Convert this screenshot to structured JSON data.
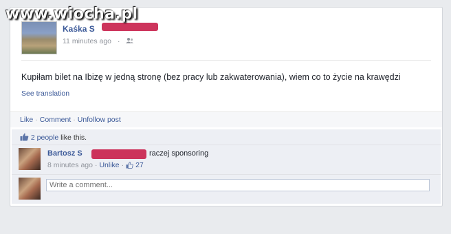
{
  "watermark": "www.wiocha.pl",
  "post": {
    "author": "Kaśka S",
    "time": "11 minutes ago",
    "text": "Kupiłam bilet na Ibizę w jedną stronę (bez pracy lub zakwaterowania), wiem co to życie na krawędzi",
    "see_translation": "See translation"
  },
  "actions": {
    "like": "Like",
    "comment": "Comment",
    "unfollow": "Unfollow post"
  },
  "likes": {
    "people": "2 people",
    "suffix": "like this."
  },
  "comment": {
    "author": "Bartosz S",
    "text": "raczej sponsoring",
    "time": "8 minutes ago",
    "unlike": "Unlike",
    "like_count": "27"
  },
  "composer": {
    "placeholder": "Write a comment..."
  },
  "colors": {
    "link": "#3b5998",
    "redaction": "#c81e4a"
  }
}
